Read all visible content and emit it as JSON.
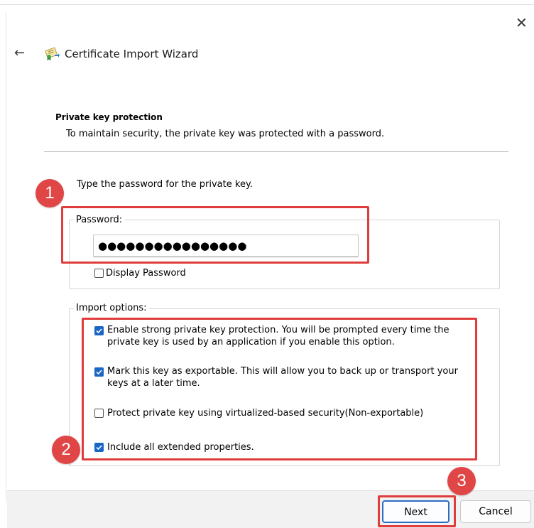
{
  "window": {
    "title": "Certificate Import Wizard",
    "close_glyph": "✕",
    "back_glyph": "←",
    "icon": "certificate-icon"
  },
  "header": {
    "heading": "Private key protection",
    "subheading": "To maintain security, the private key was protected with a password."
  },
  "password_section": {
    "instruction": "Type the password for the private key.",
    "group_label": "Password:",
    "value": "●●●●●●●●●●●●●●●●",
    "display_password_label": "Display Password",
    "display_password_checked": false
  },
  "import_options": {
    "group_label": "Import options:",
    "options": [
      {
        "label_line1": "Enable strong private key protection. You will be prompted every time the",
        "label_line2": "private key is used by an application if you enable this option.",
        "checked": true
      },
      {
        "label_line1": "Mark this key as exportable. This will allow you to back up or transport your",
        "label_line2": "keys at a later time.",
        "checked": true
      },
      {
        "label_line1": "Protect private key using virtualized-based security(Non-exportable)",
        "label_line2": "",
        "checked": false
      },
      {
        "label_line1": "Include all extended properties.",
        "label_line2": "",
        "checked": true
      }
    ]
  },
  "annotations": {
    "badge1": "1",
    "badge2": "2",
    "badge3": "3",
    "color": "#e03c3c"
  },
  "footer": {
    "next_label": "Next",
    "cancel_label": "Cancel"
  },
  "colors": {
    "accent": "#1a66c4",
    "footer_bg": "#f2f2f2"
  }
}
